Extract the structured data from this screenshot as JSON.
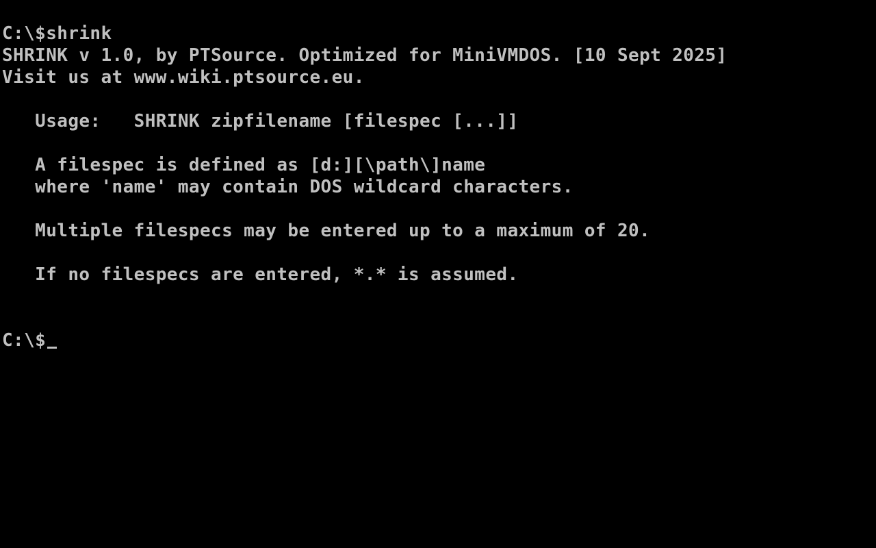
{
  "terminal": {
    "lines": [
      "C:\\$shrink",
      "SHRINK v 1.0, by PTSource. Optimized for MiniVMDOS. [10 Sept 2025]",
      "Visit us at www.wiki.ptsource.eu.",
      "",
      "   Usage:   SHRINK zipfilename [filespec [...]]",
      "",
      "   A filespec is defined as [d:][\\path\\]name",
      "   where 'name' may contain DOS wildcard characters.",
      "",
      "   Multiple filespecs may be entered up to a maximum of 20.",
      "",
      "   If no filespecs are entered, *.* is assumed."
    ],
    "prompt": "C:\\$"
  }
}
